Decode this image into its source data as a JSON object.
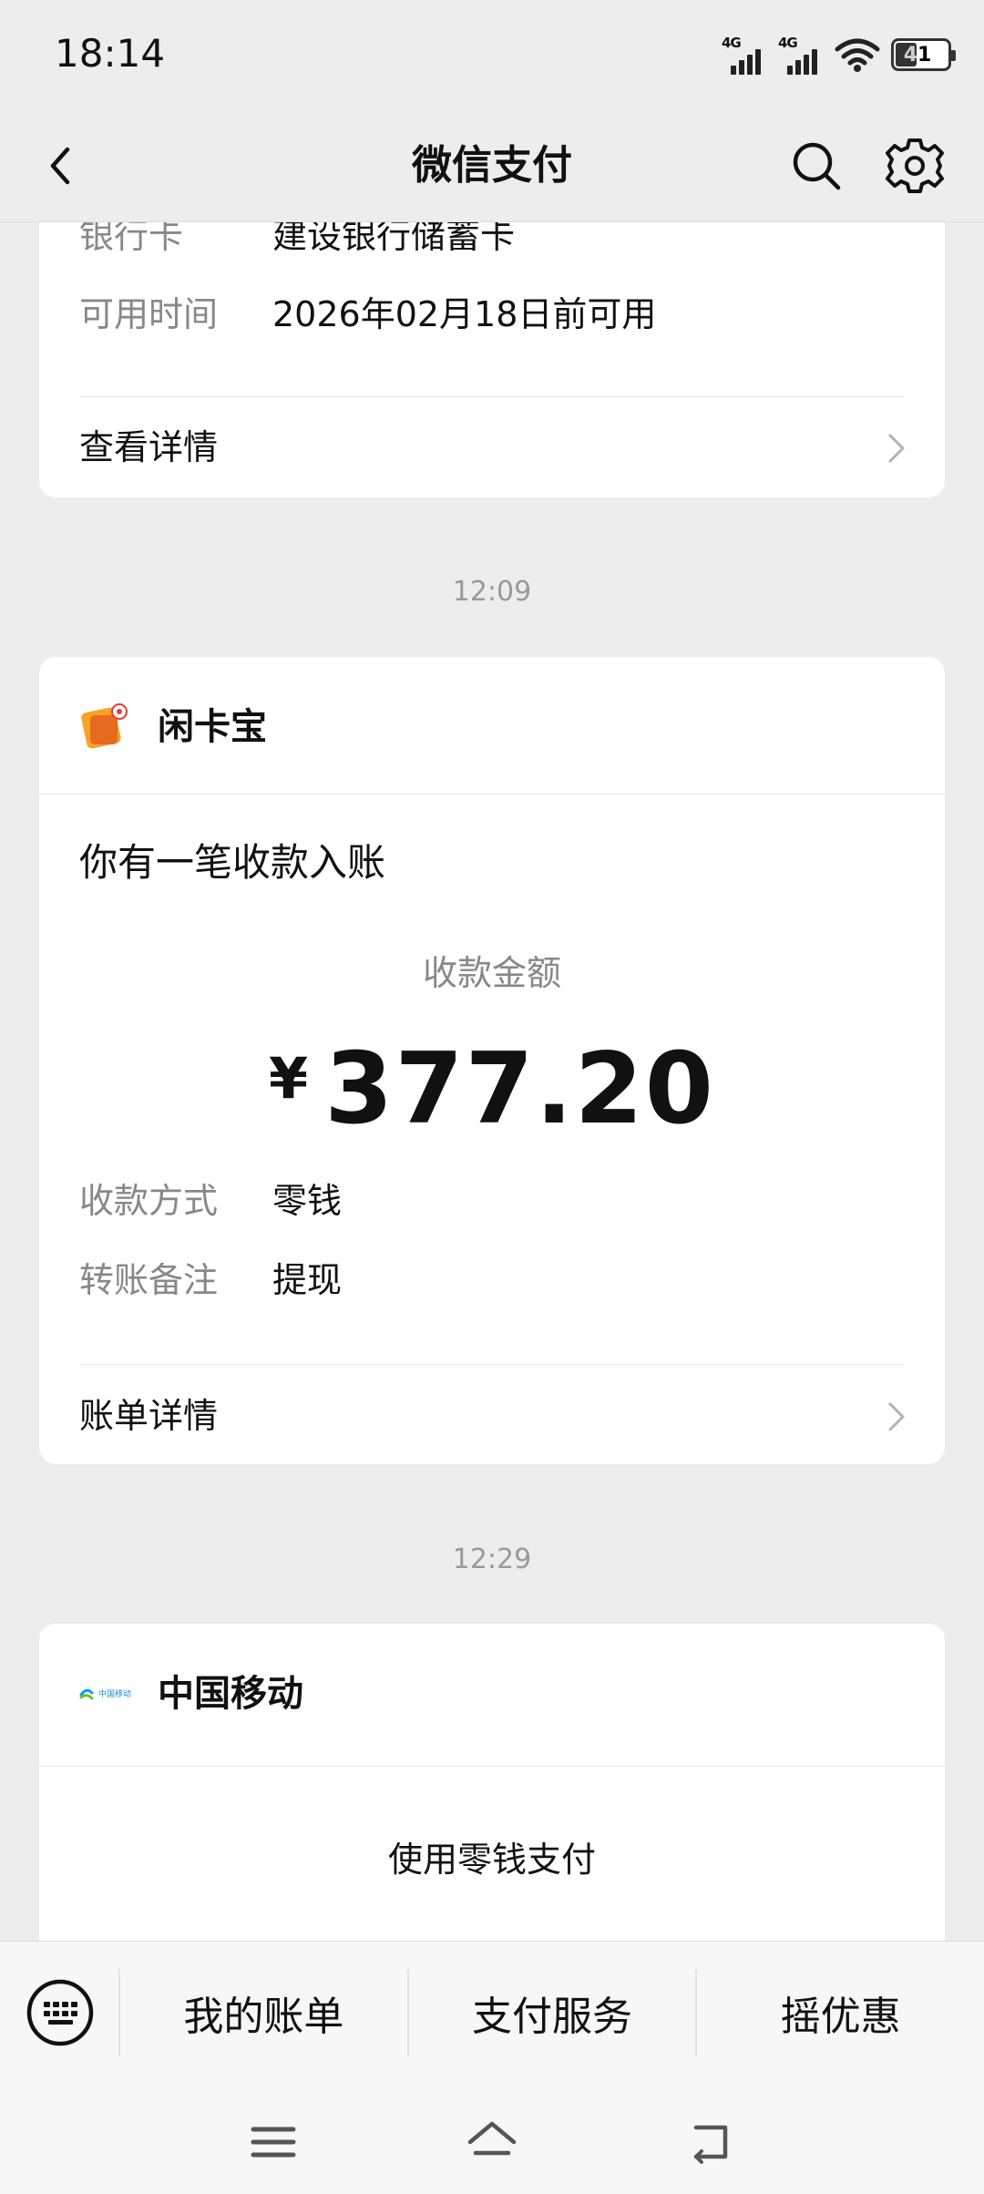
{
  "status": {
    "time": "18:14",
    "battery": "41",
    "net1": "4G",
    "net2": "4G"
  },
  "nav": {
    "title": "微信支付",
    "icons": [
      "back-icon",
      "search-icon",
      "settings-icon"
    ]
  },
  "card1": {
    "rows": [
      {
        "key": "银行卡",
        "value": "建设银行储蓄卡"
      },
      {
        "key": "可用时间",
        "value": "2026年02月18日前可用"
      }
    ],
    "link": "查看详情"
  },
  "ts1": "12:09",
  "card2": {
    "merchant": "闲卡宝",
    "heading": "你有一笔收款入账",
    "amount_label": "收款金额",
    "currency": "¥",
    "amount": "377.20",
    "rows": [
      {
        "key": "收款方式",
        "value": "零钱"
      },
      {
        "key": "转账备注",
        "value": "提现"
      }
    ],
    "link": "账单详情"
  },
  "ts2": "12:29",
  "card3": {
    "merchant": "中国移动",
    "logo_text": "中国移动",
    "body": "使用零钱支付"
  },
  "bottom": {
    "tabs": [
      "我的账单",
      "支付服务",
      "摇优惠"
    ]
  },
  "colors": {
    "bg": "#ededed",
    "card": "#ffffff",
    "muted": "#888888",
    "merchant_logo": "#f4a228"
  }
}
